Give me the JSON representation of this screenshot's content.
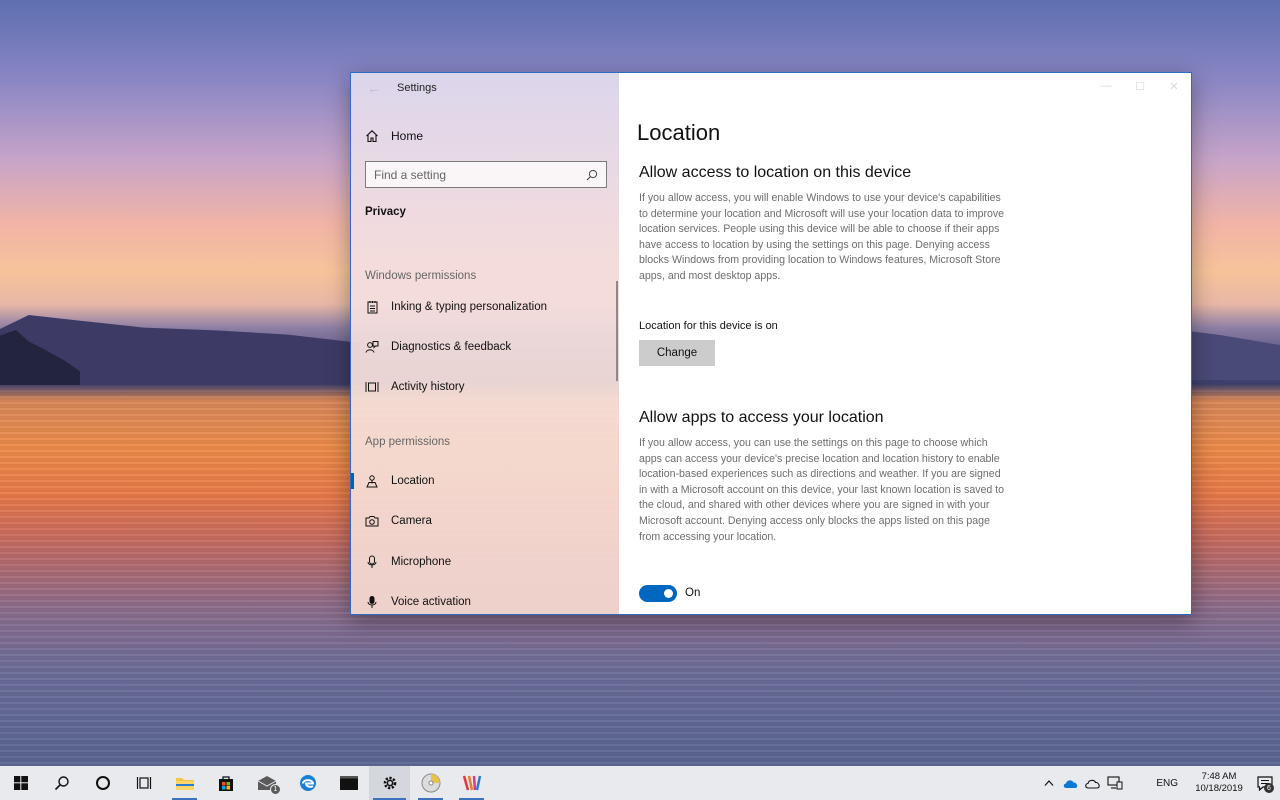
{
  "window": {
    "title": "Settings",
    "back_glyph": "←",
    "controls": {
      "minimize": "—",
      "maximize": "☐",
      "close": "✕"
    }
  },
  "sidebar": {
    "home_label": "Home",
    "search_placeholder": "Find a setting",
    "section": "Privacy",
    "groups": {
      "windows_permissions": "Windows permissions",
      "app_permissions": "App permissions"
    },
    "items": [
      {
        "label": "Inking & typing personalization",
        "icon": "notepad-icon"
      },
      {
        "label": "Diagnostics & feedback",
        "icon": "feedback-icon"
      },
      {
        "label": "Activity history",
        "icon": "timeline-icon"
      },
      {
        "label": "Location",
        "icon": "location-icon",
        "active": true
      },
      {
        "label": "Camera",
        "icon": "camera-icon"
      },
      {
        "label": "Microphone",
        "icon": "microphone-icon"
      },
      {
        "label": "Voice activation",
        "icon": "voice-icon"
      }
    ]
  },
  "main": {
    "title": "Location",
    "device_section": {
      "heading": "Allow access to location on this device",
      "description": "If you allow access, you will enable Windows to use your device's capabilities to determine your location and Microsoft will use your location data to improve location services. People using this device will be able to choose if their apps have access to location by using the settings on this page. Denying access blocks Windows from providing location to Windows features, Microsoft Store apps, and most desktop apps.",
      "status": "Location for this device is on",
      "button_label": "Change"
    },
    "apps_section": {
      "heading": "Allow apps to access your location",
      "description": "If you allow access, you can use the settings on this page to choose which apps can access your device's precise location and location history to enable location-based experiences such as directions and weather. If you are signed in with a Microsoft account on this device, your last known location is saved to the cloud, and shared with other devices where you are signed in with your Microsoft account. Denying access only blocks the apps listed on this page from accessing your location.",
      "toggle_state": "On"
    }
  },
  "taskbar": {
    "mail_badge": "1",
    "tray": {
      "language": "ENG",
      "time": "7:48 AM",
      "date": "10/18/2019",
      "notification_count": "6"
    }
  },
  "colors": {
    "accent": "#0067c0",
    "window_border": "#2c6cc4",
    "taskbar_bg": "#e9eaee"
  }
}
